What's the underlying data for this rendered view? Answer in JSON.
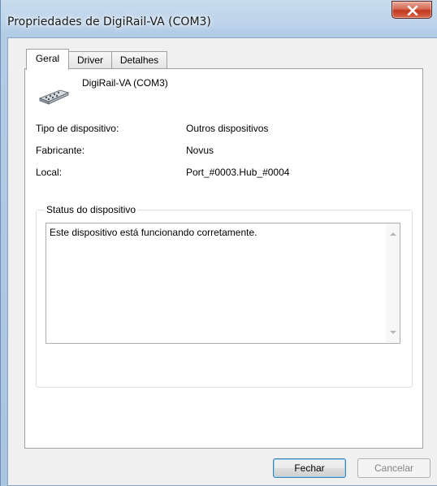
{
  "window": {
    "title": "Propriedades de DigiRail-VA (COM3)",
    "close_label": "×"
  },
  "tabs": [
    {
      "label": "Geral",
      "active": true
    },
    {
      "label": "Driver",
      "active": false
    },
    {
      "label": "Detalhes",
      "active": false
    }
  ],
  "device": {
    "name": "DigiRail-VA (COM3)",
    "icon": "serial-port-icon"
  },
  "properties": [
    {
      "label": "Tipo de dispositivo:",
      "value": "Outros dispositivos"
    },
    {
      "label": "Fabricante:",
      "value": "Novus"
    },
    {
      "label": "Local:",
      "value": "Port_#0003.Hub_#0004"
    }
  ],
  "status": {
    "group_title": "Status do dispositivo",
    "text": "Este dispositivo está funcionando corretamente."
  },
  "buttons": {
    "close_label": "Fechar",
    "cancel_label": "Cancelar"
  },
  "colors": {
    "titlebar": "#bcd3ea",
    "close_button": "#c2381f",
    "dialog_bg": "#f0f0f0"
  }
}
